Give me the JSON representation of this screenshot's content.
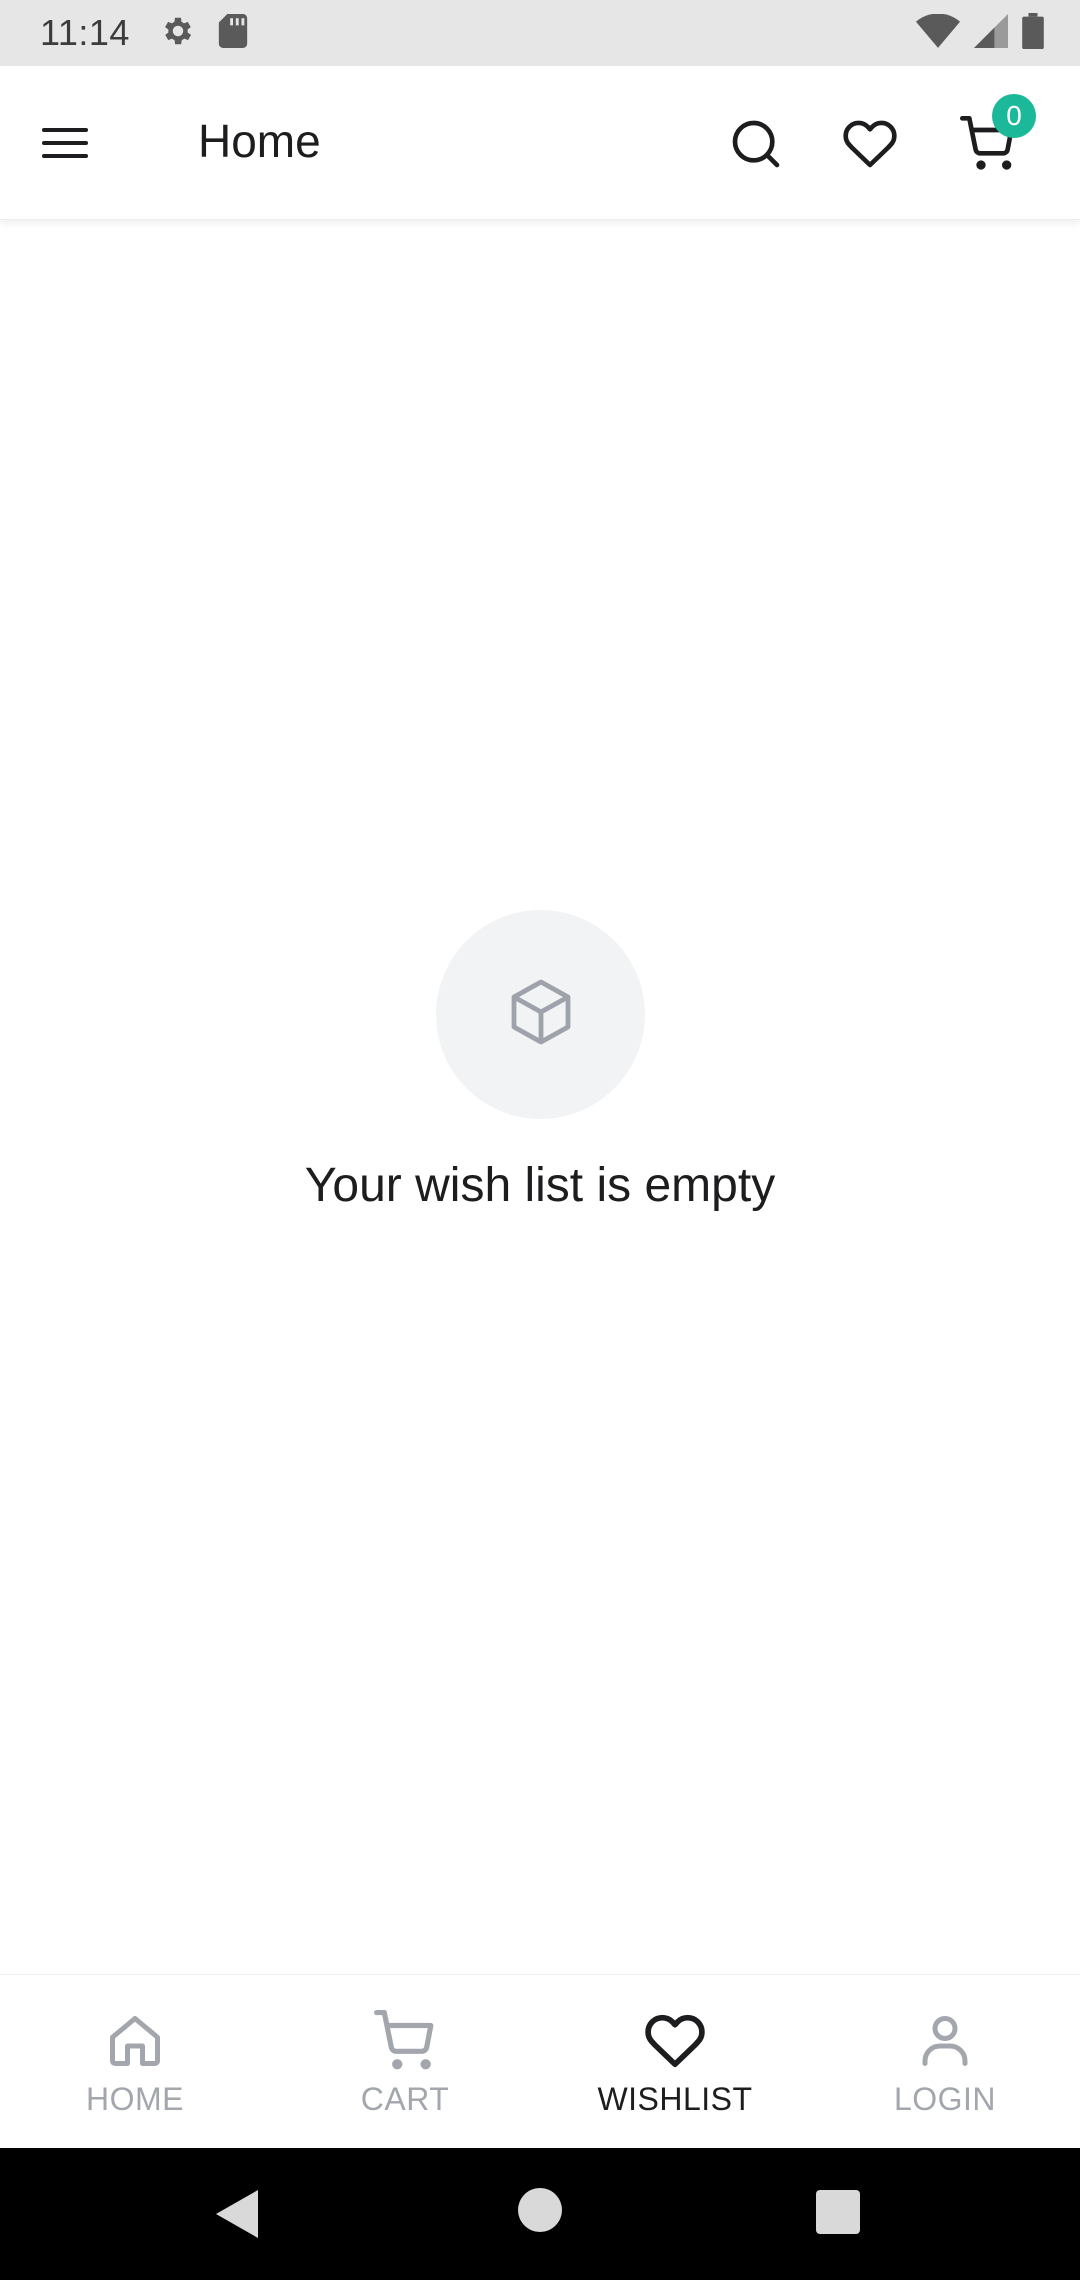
{
  "status_bar": {
    "time": "11:14",
    "icons_left": [
      "settings-icon",
      "sd-card-icon"
    ],
    "icons_right": [
      "wifi-icon",
      "signal-icon",
      "battery-icon"
    ]
  },
  "app_bar": {
    "title": "Home",
    "cart_count": "0",
    "icons": [
      "menu-icon",
      "search-icon",
      "heart-icon",
      "cart-icon"
    ]
  },
  "empty_state": {
    "icon": "box-icon",
    "message": "Your wish list is empty"
  },
  "bottom_nav": {
    "items": [
      {
        "label": "HOME",
        "icon": "home-icon",
        "active": false
      },
      {
        "label": "CART",
        "icon": "cart-icon",
        "active": false
      },
      {
        "label": "WISHLIST",
        "icon": "heart-icon",
        "active": true
      },
      {
        "label": "LOGIN",
        "icon": "user-icon",
        "active": false
      }
    ]
  },
  "colors": {
    "accent": "#1bb99a",
    "text_primary": "#1d1d1f",
    "text_inactive": "#a3a7ad",
    "status_bar_bg": "#e6e6e6",
    "empty_circle_bg": "#f2f3f5"
  }
}
